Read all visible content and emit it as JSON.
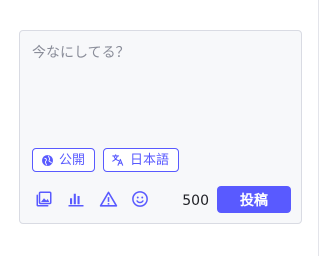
{
  "composer": {
    "placeholder": "今なにしてる？",
    "value": ""
  },
  "chips": {
    "visibility": {
      "label": "公開",
      "icon": "globe-icon"
    },
    "language": {
      "label": "日本語",
      "icon": "translate-icon"
    }
  },
  "toolbar": {
    "icons": [
      "image-icon",
      "poll-icon",
      "warning-icon",
      "emoji-icon"
    ]
  },
  "char_counter": "500",
  "post_button": {
    "label": "投稿"
  },
  "colors": {
    "accent": "#595aff",
    "composer_bg": "#f7f8fa",
    "border": "#d9dbe3"
  }
}
